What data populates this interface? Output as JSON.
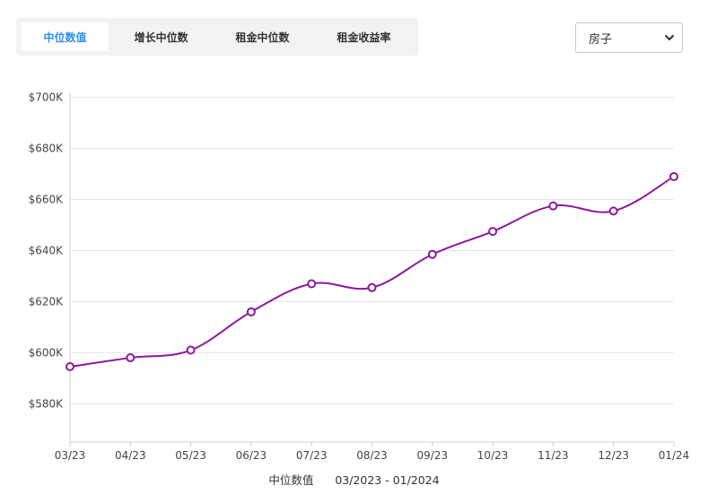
{
  "tabs": [
    {
      "label": "中位数值",
      "active": true
    },
    {
      "label": "增长中位数",
      "active": false
    },
    {
      "label": "租金中位数",
      "active": false
    },
    {
      "label": "租金收益率",
      "active": false
    }
  ],
  "property_select": {
    "value": "房子"
  },
  "footer": {
    "series_label": "中位数值",
    "date_range": "03/2023 - 01/2024"
  },
  "colors": {
    "accent": "#2e8fe6",
    "line": "#8b1a9b",
    "grid": "#e6e6e6"
  },
  "chart_data": {
    "type": "line",
    "x": [
      "03/23",
      "04/23",
      "05/23",
      "06/23",
      "07/23",
      "08/23",
      "09/23",
      "10/23",
      "11/23",
      "12/23",
      "01/24"
    ],
    "series": [
      {
        "values": [
          594500,
          598000,
          601000,
          616000,
          627000,
          625500,
          638500,
          647500,
          657500,
          655500,
          669000
        ]
      }
    ],
    "ylim": [
      565000,
      702000
    ],
    "yticks": [
      580000,
      600000,
      620000,
      640000,
      660000,
      680000,
      700000
    ],
    "ytick_labels": [
      "$580K",
      "$600K",
      "$620K",
      "$640K",
      "$660K",
      "$680K",
      "$700K"
    ],
    "grid": true,
    "markers": "hollow-circle"
  }
}
